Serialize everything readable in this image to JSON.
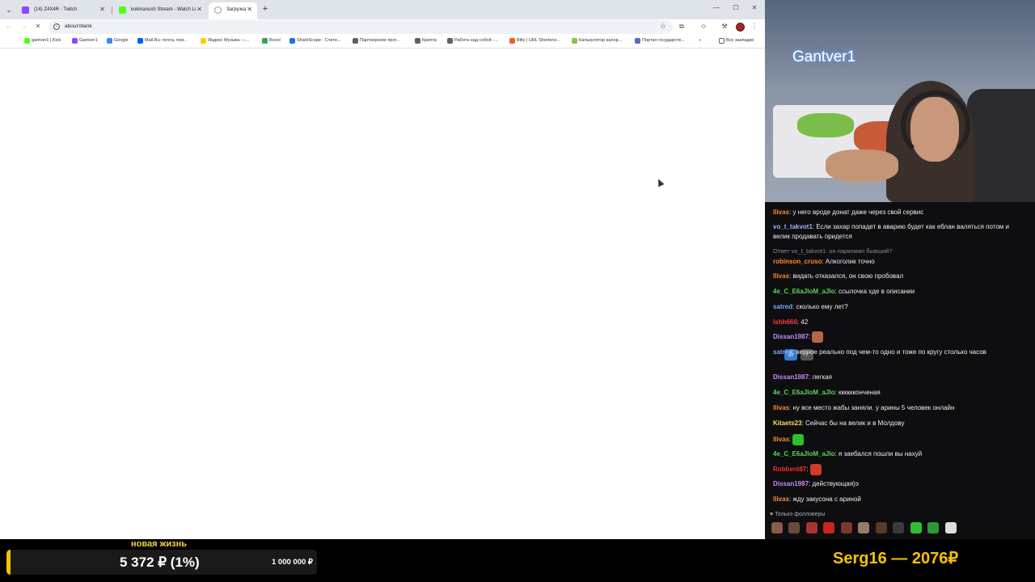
{
  "browser": {
    "tabs": [
      {
        "title": "(14) Z4X4R - Twitch",
        "color": "#9146ff"
      },
      {
        "title": "kokmanush Stream - Watch Li",
        "color": "#53fc18"
      },
      {
        "title": "Загрузка",
        "color": "#ffffff"
      }
    ],
    "address": "about:blank",
    "bookmarks": [
      {
        "label": "gantver1 | Kick",
        "color": "#53fc18"
      },
      {
        "label": "Gantver1",
        "color": "#9146ff"
      },
      {
        "label": "Google",
        "color": "#4285f4"
      },
      {
        "label": "Mail.Ru: почта, пои...",
        "color": "#005ff9"
      },
      {
        "label": "Яндекс Музыка —...",
        "color": "#ffcc00"
      },
      {
        "label": "Boxol",
        "color": "#34a853"
      },
      {
        "label": "SharkScope - Стати...",
        "color": "#1a73e8"
      },
      {
        "label": "Партнерские прог...",
        "color": "#5f6368"
      },
      {
        "label": "Крипта",
        "color": "#5f6368"
      },
      {
        "label": "Работа над собой -...",
        "color": "#5f6368"
      },
      {
        "label": "Bitly | URL Shortene...",
        "color": "#ee6123"
      },
      {
        "label": "Калькулятор калор...",
        "color": "#8bc34a"
      },
      {
        "label": "Портал государств...",
        "color": "#5c6bc0"
      }
    ],
    "all_bookmarks": "Все закладки"
  },
  "cam": {
    "name": "Gantver1"
  },
  "chat": {
    "messages": [
      {
        "user": "llivas",
        "color": "#ff8c2a",
        "text": "у него вроде донат даже через свой сервис"
      },
      {
        "user": "vo_t_takvot1",
        "color": "#9ab4ff",
        "text": "Если захар попадет в аварию будет как еблан валяться потом и велик продавать придется"
      },
      {
        "user": "robinson_cruso",
        "color": "#ff8c2a",
        "text": "Алкоголик точно"
      },
      {
        "user": "llivas",
        "color": "#ff8c2a",
        "text": "видать отказался, он свою пробовал"
      },
      {
        "user": "4e_C_E6aJloM_aJlo",
        "color": "#5cd65c",
        "text": "ссылочка хде в описании"
      },
      {
        "user": "satred",
        "color": "#7ea6ff",
        "text": "сколько ему лет?"
      },
      {
        "user": "lshh666",
        "color": "#ff3b3b",
        "text": "42"
      },
      {
        "user": "Dissan1987",
        "color": "#c48cff",
        "text": ""
      },
      {
        "user": "satred",
        "color": "#7ea6ff",
        "text": "верное реально под чем-то одно и тоже по кругу столько часов"
      },
      {
        "user": "Dissan1987",
        "color": "#c48cff",
        "text": "легкая"
      },
      {
        "user": "4e_C_E6aJloM_aJlo",
        "color": "#5cd65c",
        "text": "кккккконченая"
      },
      {
        "user": "llivas",
        "color": "#ff8c2a",
        "text": "ну все место жабы заняли. у арины 5 человек онлайн"
      },
      {
        "user": "Kitaets23",
        "color": "#ffd966",
        "text": "Сейчас бы на велик и в Молдову"
      },
      {
        "user": "llivas",
        "color": "#ff8c2a",
        "text": ""
      },
      {
        "user": "4e_C_E6aJloM_aJlo",
        "color": "#5cd65c",
        "text": "я заебался пошли вы нахуй"
      },
      {
        "user": "Robbent87",
        "color": "#ff2d2d",
        "text": ""
      },
      {
        "user": "Dissan1987",
        "color": "#c48cff",
        "text": "действующая)э"
      },
      {
        "user": "llivas",
        "color": "#ff8c2a",
        "text": "жду закусона с ариной"
      }
    ],
    "reply": "Ответ vo_t_takvot1: он наркоман бывший?",
    "followers_only": "Только фолловеры"
  },
  "goal": {
    "title": "новая жизнь",
    "amount": "5 372 ₽ (1%)",
    "target": "1 000 000 ₽",
    "progress": 0.01
  },
  "donor": {
    "text": "Serg16 — 2076₽"
  }
}
